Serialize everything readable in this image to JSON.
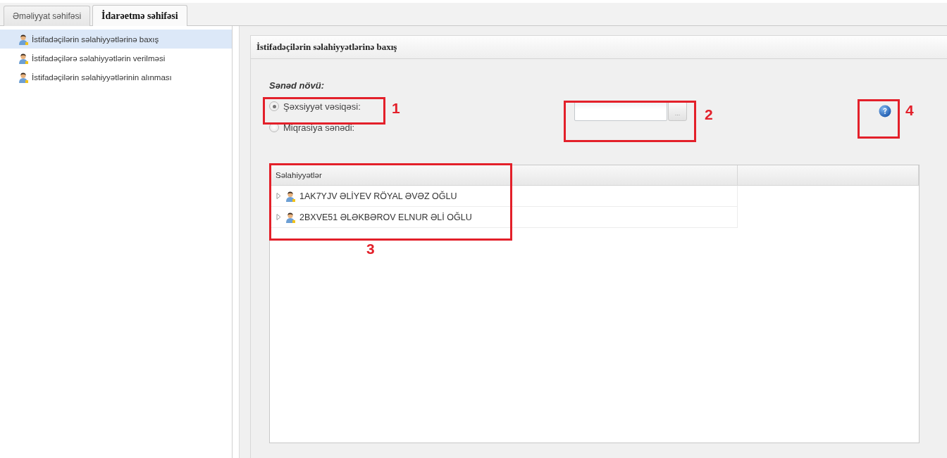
{
  "tabs": [
    {
      "label": "Əməliyyat səhifəsi",
      "selected": false
    },
    {
      "label": "İdarəetmə səhifəsi",
      "selected": true
    }
  ],
  "sidebar": {
    "items": [
      {
        "label": "İstifadəçilərin səlahiyyətlərinə baxış",
        "selected": true
      },
      {
        "label": "İstifadəçilərə səlahiyyətlərin verilməsi",
        "selected": false
      },
      {
        "label": "İstifadəçilərin səlahiyyətlərinin alınması",
        "selected": false
      }
    ]
  },
  "panel": {
    "title": "İstifadəçilərin səlahiyyətlərinə baxış",
    "document_type": {
      "label": "Sənəd növü:",
      "options": [
        {
          "label": "Şəxsiyyət vəsiqəsi:",
          "selected": true
        },
        {
          "label": "Miqrasiya sənədi:",
          "selected": false
        }
      ]
    },
    "browse_button": "...",
    "grid": {
      "columns": [
        "Səlahiyyətlər"
      ],
      "rows": [
        {
          "label": "1AK7YJV ƏLİYEV RÖYAL ƏVƏZ OĞLU",
          "expanded": false
        },
        {
          "label": "2BXVE51 ƏLƏKBƏROV ELNUR ƏLİ OĞLU",
          "expanded": false
        }
      ]
    }
  },
  "annotations": [
    {
      "label": "1"
    },
    {
      "label": "2"
    },
    {
      "label": "3"
    },
    {
      "label": "4"
    }
  ]
}
